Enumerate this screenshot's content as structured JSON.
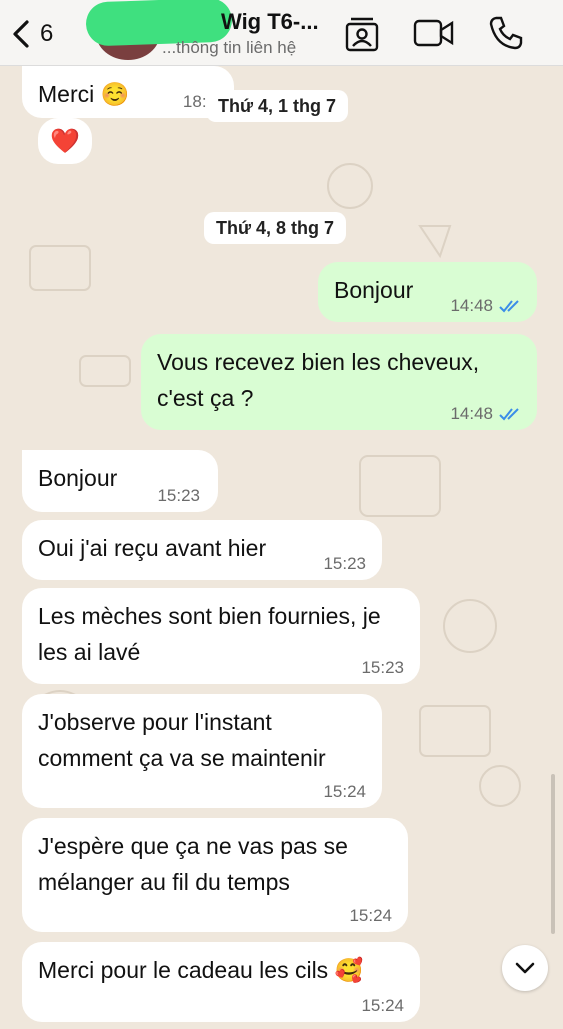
{
  "header": {
    "back_count": "6",
    "chat_name": "Wig T6-...",
    "chat_subtitle": "...thông tin liên hệ"
  },
  "icons": {
    "back": "chevron-left-icon",
    "contact": "contact-card-icon",
    "video": "video-call-icon",
    "phone": "phone-icon",
    "scroll": "chevron-down-icon"
  },
  "messages": [
    {
      "dir": "in",
      "text": "Merci ☺️",
      "time": "18:2"
    },
    {
      "dir": "in",
      "text": "❤️",
      "time": ""
    },
    {
      "dir": "out",
      "text": "Bonjour",
      "time": "14:48"
    },
    {
      "dir": "out",
      "text": "Vous recevez bien les cheveux, c'est ça ?",
      "time": "14:48"
    },
    {
      "dir": "in",
      "text": "Bonjour",
      "time": "15:23"
    },
    {
      "dir": "in",
      "text": "Oui j'ai reçu avant hier",
      "time": "15:23"
    },
    {
      "dir": "in",
      "text": "Les mèches sont bien fournies, je les ai lavé",
      "time": "15:23"
    },
    {
      "dir": "in",
      "text": "J'observe pour l'instant comment ça va se maintenir",
      "time": "15:24"
    },
    {
      "dir": "in",
      "text": "J'espère que ça ne vas pas se mélanger au fil du temps",
      "time": "15:24"
    },
    {
      "dir": "in",
      "text": "Merci pour le cadeau les cils 🥰",
      "time": "15:24"
    }
  ],
  "dates": [
    "Thứ 4, 1 thg 7",
    "Thứ 4, 8 thg 7"
  ],
  "colors": {
    "background": "#efe7dc",
    "incoming": "#ffffff",
    "outgoing": "#d9fdd3",
    "read_ticks": "#3b8de8"
  }
}
